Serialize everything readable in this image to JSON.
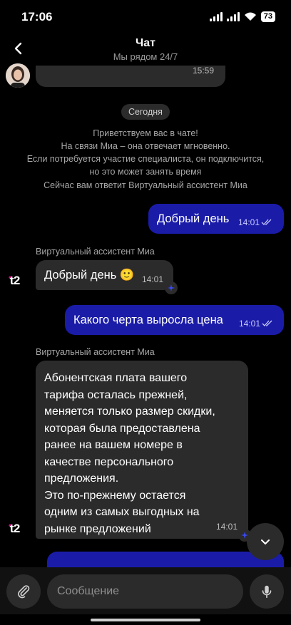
{
  "status_bar": {
    "time": "17:06",
    "battery": "73"
  },
  "header": {
    "title": "Чат",
    "subtitle": "Мы рядом 24/7"
  },
  "prev_message": {
    "time": "15:59"
  },
  "date_separator": "Сегодня",
  "system": {
    "welcome_lines": [
      "Приветствуем вас в чате!",
      "На связи Миа – она отвечает мгновенно.",
      "Если потребуется участие специалиста, он подключится,",
      "но это может занять время"
    ],
    "assistant_notice": "Сейчас вам ответит Виртуальный ассистент Миа"
  },
  "brand": {
    "logo": "t2"
  },
  "messages": [
    {
      "type": "out",
      "text": "Добрый день",
      "time": "14:01"
    },
    {
      "type": "in",
      "sender": "Виртуальный ассистент Миа",
      "text": "Добрый день 🙂",
      "time": "14:01"
    },
    {
      "type": "out",
      "text": "Какого черта выросла цена",
      "time": "14:01"
    },
    {
      "type": "in",
      "sender": "Виртуальный ассистент Миа",
      "lines": [
        "Абонентская плата вашего",
        "тарифа осталась прежней,",
        "меняется только размер скидки,",
        "которая была предоставлена",
        "ранее на вашем номере в",
        "качестве персонального",
        "предложения.",
        "Это по-прежнему остается",
        "одним из самых выгодных на",
        "рынке предложений"
      ],
      "time": "14:01"
    }
  ],
  "composer": {
    "placeholder": "Сообщение"
  },
  "colors": {
    "outgoing": "#1a1ca8",
    "incoming": "#2b2b2b",
    "background": "#000000",
    "brand_dot": "#e6007e"
  }
}
